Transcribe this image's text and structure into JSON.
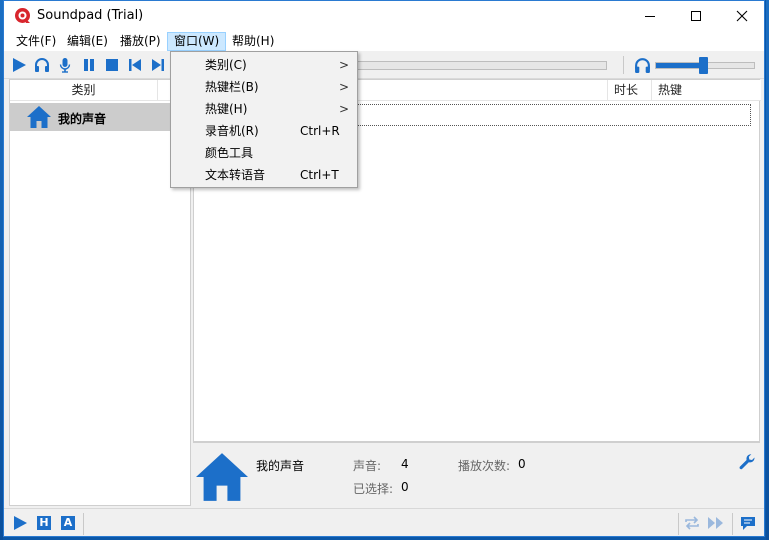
{
  "app": {
    "title": "Soundpad (Trial)",
    "accent_color": "#1c6fc9",
    "logo_color": "#d8262d"
  },
  "window_controls": {
    "minimize_icon": "minimize-icon",
    "maximize_icon": "maximize-icon",
    "close_icon": "close-icon"
  },
  "menubar": {
    "items": [
      {
        "label": "文件(F)"
      },
      {
        "label": "编辑(E)"
      },
      {
        "label": "播放(P)"
      },
      {
        "label": "窗口(W)"
      },
      {
        "label": "帮助(H)"
      }
    ]
  },
  "window_menu": {
    "items": [
      {
        "label": "类别(C)",
        "shortcut": "",
        "submenu": ">"
      },
      {
        "label": "热键栏(B)",
        "shortcut": "",
        "submenu": ">"
      },
      {
        "label": "热键(H)",
        "shortcut": "",
        "submenu": ">"
      },
      {
        "label": "录音机(R)",
        "shortcut": "Ctrl+R",
        "submenu": ""
      },
      {
        "label": "颜色工具",
        "shortcut": "",
        "submenu": ""
      },
      {
        "label": "文本转语音",
        "shortcut": "Ctrl+T",
        "submenu": ""
      }
    ]
  },
  "toolbar": {
    "buttons": [
      "play-icon",
      "headphones-icon",
      "microphone-icon",
      "pause-icon",
      "stop-icon",
      "previous-icon",
      "next-icon"
    ],
    "volume_level": 0.48
  },
  "left_panel": {
    "header": "类别",
    "categories": [
      {
        "label": "我的声音",
        "icon": "home-icon"
      }
    ]
  },
  "sound_list": {
    "columns": {
      "title": "",
      "duration": "时长",
      "hotkey": "热键"
    }
  },
  "info": {
    "title": "我的声音",
    "sounds_label": "声音:",
    "sounds_value": "4",
    "play_count_label": "播放次数:",
    "play_count_value": "0",
    "selected_label": "已选择:",
    "selected_value": "0"
  },
  "statusbar": {
    "left_buttons": [
      {
        "icon": "play-icon"
      },
      {
        "letter": "H"
      },
      {
        "letter": "A"
      }
    ],
    "right_buttons": [
      "repeat-icon",
      "fast-forward-icon",
      "chat-icon"
    ]
  }
}
